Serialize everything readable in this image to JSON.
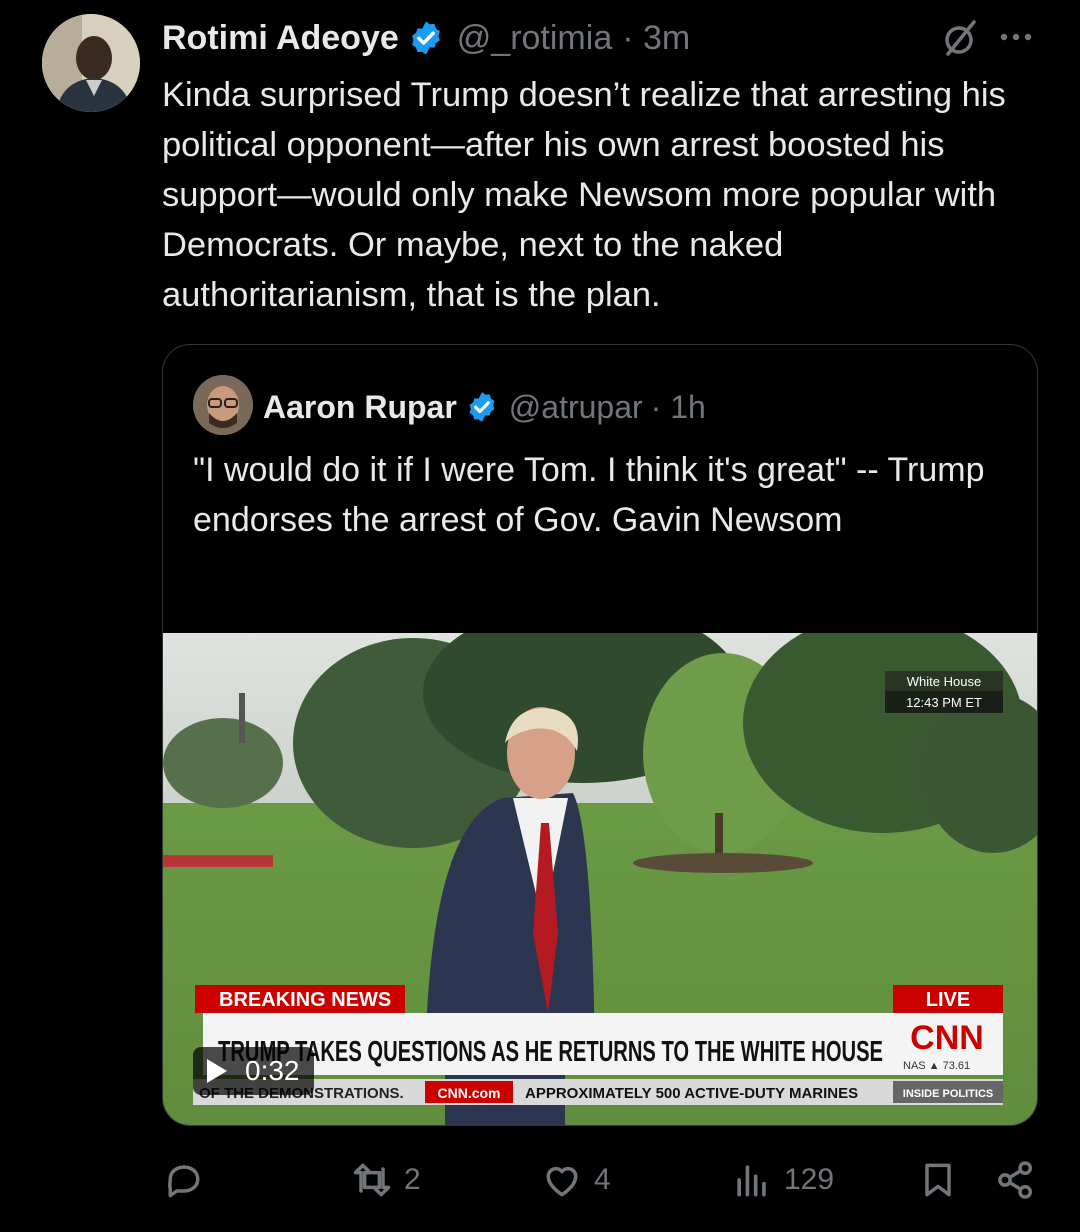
{
  "tweet": {
    "author_name": "Rotimi Adeoye",
    "handle": "@_rotimia",
    "time": "· 3m",
    "text": "Kinda surprised Trump doesn’t realize that arresting his political opponent—after his own arrest boosted his support—would only make Newsom more popular with Democrats. Or maybe, next to the naked authoritarianism, that is the plan."
  },
  "quote": {
    "author_name": "Aaron Rupar",
    "handle": "@atrupar",
    "time": "· 1h",
    "text": "\"I would do it if I were Tom. I think it's great\" -- Trump endorses the arrest of Gov. Gavin Newsom",
    "video": {
      "duration": "0:32",
      "location_label": "White House",
      "time_label": "12:43 PM ET",
      "breaking_label": "BREAKING NEWS",
      "live_label": "LIVE",
      "headline": "TRUMP TAKES QUESTIONS AS HE RETURNS TO THE WHITE HOUSE",
      "network": "CNN",
      "ticker_left": "OF THE DEMONSTRATIONS.",
      "ticker_site": "CNN.com",
      "ticker_right": "APPROXIMATELY 500 ACTIVE-DUTY MARINES",
      "ticker_show": "INSIDE POLITICS",
      "market": "NAS ▲ 73.61"
    }
  },
  "actions": {
    "reply_count": "",
    "retweet_count": "2",
    "like_count": "4",
    "view_count": "129"
  },
  "colors": {
    "background": "#000000",
    "text": "#e7e9ea",
    "secondary": "#71767b",
    "verified": "#1d9bf0",
    "cnn_red": "#cc0000"
  }
}
